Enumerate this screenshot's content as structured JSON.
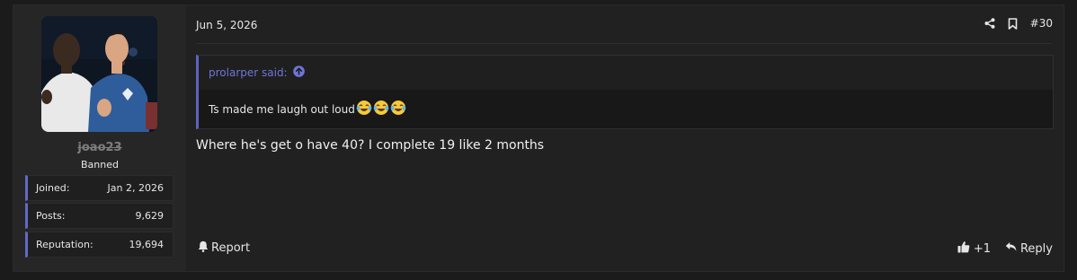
{
  "user": {
    "username": "joao23",
    "title": "Banned",
    "stats": [
      {
        "label": "Joined:",
        "value": "Jan 2, 2026"
      },
      {
        "label": "Posts:",
        "value": "9,629"
      },
      {
        "label": "Reputation:",
        "value": "19,694"
      }
    ]
  },
  "post": {
    "date": "Jun 5, 2026",
    "number": "#30",
    "quote": {
      "author_line": "prolarper said:",
      "text": "Ts made me laugh out loud",
      "emoji_count": 3
    },
    "body": "Where he's get o have 40? I complete 19 like 2 months",
    "report_label": "Report",
    "like_count": "+1",
    "reply_label": "Reply"
  },
  "colors": {
    "accent": "#6269c5",
    "quote_link": "#6f75d8",
    "background": "#1b1b1b",
    "post_bg": "#212121",
    "user_cell_bg": "#262626"
  },
  "icons": {
    "share": "share-icon",
    "bookmark": "bookmark-icon",
    "quote_up": "arrow-up-circle-icon",
    "report": "bell-icon",
    "like": "thumbs-up-icon",
    "reply": "reply-icon"
  }
}
